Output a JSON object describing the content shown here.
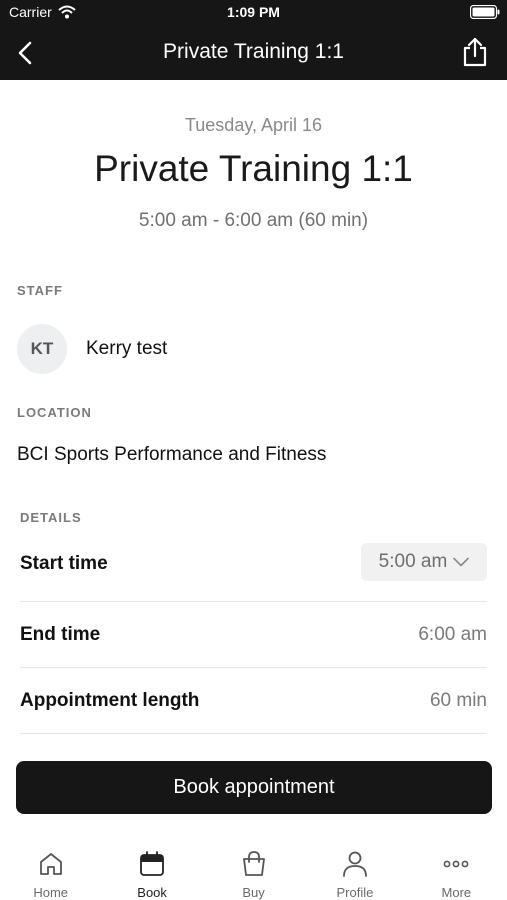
{
  "status_bar": {
    "carrier": "Carrier",
    "time": "1:09 PM"
  },
  "nav": {
    "title": "Private Training 1:1",
    "back_icon": "chevron-left-icon",
    "share_icon": "share-icon"
  },
  "header": {
    "date": "Tuesday, April 16",
    "title": "Private Training 1:1",
    "time_range": "5:00 am - 6:00 am (60 min)"
  },
  "staff": {
    "section_label": "STAFF",
    "initials": "KT",
    "name": "Kerry test"
  },
  "location": {
    "section_label": "LOCATION",
    "name": "BCI Sports Performance and Fitness"
  },
  "details": {
    "section_label": "DETAILS",
    "start_time_label": "Start time",
    "start_time_value": "5:00 am",
    "end_time_label": "End time",
    "end_time_value": "6:00 am",
    "length_label": "Appointment length",
    "length_value": "60 min"
  },
  "actions": {
    "book_label": "Book appointment"
  },
  "tabs": [
    {
      "label": "Home",
      "icon": "home-icon"
    },
    {
      "label": "Book",
      "icon": "calendar-icon",
      "active": true
    },
    {
      "label": "Buy",
      "icon": "shopping-bag-icon"
    },
    {
      "label": "Profile",
      "icon": "person-icon"
    },
    {
      "label": "More",
      "icon": "more-icon"
    }
  ],
  "colors": {
    "bar_background": "#161616",
    "muted_text": "#7a7a7a"
  }
}
